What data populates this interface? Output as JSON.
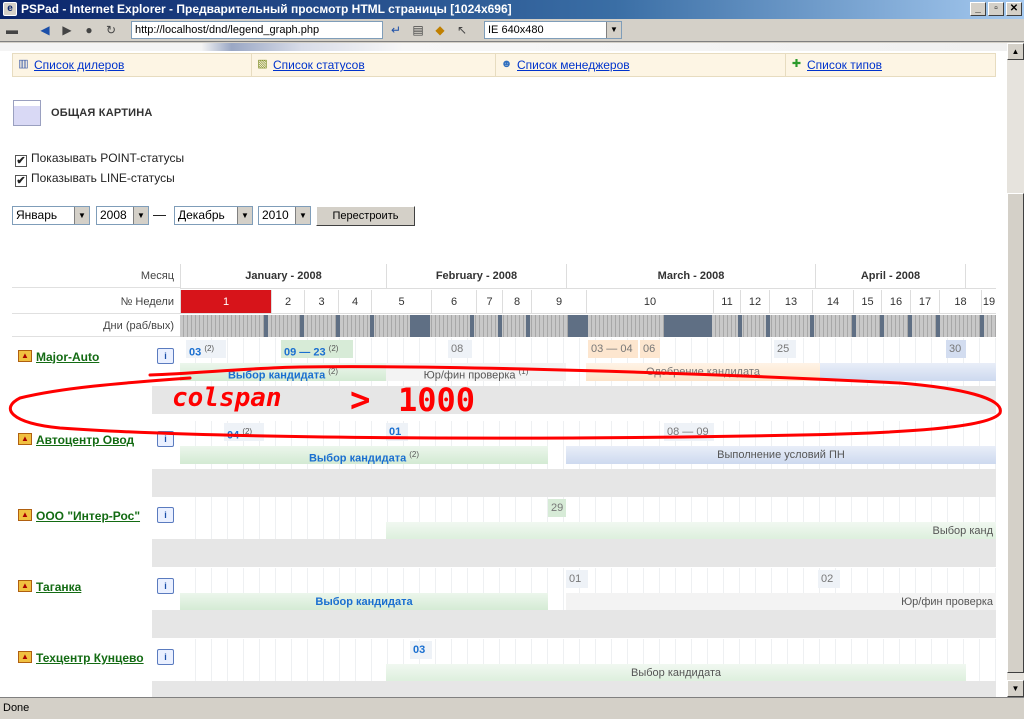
{
  "window": {
    "title": "PSPad - Internet Explorer - Предварительный просмотр HTML страницы  [1024x696]",
    "url": "http://localhost/dnd/legend_graph.php",
    "browser_mode": "IE 640x480",
    "status": "Done"
  },
  "nav": {
    "dealers": "Список дилеров",
    "statuses": "Список статусов",
    "managers": "Список менеджеров",
    "types": "Список типов"
  },
  "section_title": "ОБЩАЯ КАРТИНА",
  "filters": {
    "show_point": "Показывать POINT-статусы",
    "show_line": "Показывать LINE-статусы",
    "from_month": "Январь",
    "from_year": "2008",
    "dash": "—",
    "to_month": "Декабрь",
    "to_year": "2010",
    "rebuild": "Перестроить"
  },
  "grid": {
    "month_label": "Месяц",
    "week_label": "№ Недели",
    "days_label": "Дни (раб/вых)",
    "months": [
      "January - 2008",
      "February - 2008",
      "March - 2008",
      "April - 2008"
    ],
    "weeks": [
      "1",
      "2",
      "3",
      "4",
      "5",
      "6",
      "7",
      "8",
      "9",
      "10",
      "11",
      "12",
      "13",
      "14",
      "15",
      "16",
      "17",
      "18",
      "19"
    ]
  },
  "dealers": [
    {
      "name": "Major-Auto",
      "points": [
        "03",
        "(2)",
        "09 — 23",
        "(2)",
        "08",
        "03 — 04",
        "06",
        "25",
        "30"
      ],
      "lines": [
        "Выбор кандидата",
        "(2)",
        "Юр/фин проверка",
        "(1)",
        "Одобрение кандидата"
      ]
    },
    {
      "name": "Автоцентр Овод",
      "points": [
        "04",
        "(2)",
        "01",
        "08 — 09"
      ],
      "lines": [
        "Выбор кандидата",
        "(2)",
        "Выполнение условий ПН"
      ]
    },
    {
      "name": "ООО \"Интер-Рос\"",
      "points": [
        "29"
      ],
      "lines": [
        "Выбор канд"
      ]
    },
    {
      "name": "Таганка",
      "points": [
        "01",
        "02"
      ],
      "lines": [
        "Выбор кандидата",
        "Юр/фин проверка"
      ]
    },
    {
      "name": "Техцентр Кунцево",
      "points": [
        "03"
      ],
      "lines": [
        "Выбор кандидата"
      ]
    }
  ],
  "annotation": {
    "left": "colspan",
    "arrow": ">",
    "right": "1000",
    "color": "#ff0000"
  }
}
